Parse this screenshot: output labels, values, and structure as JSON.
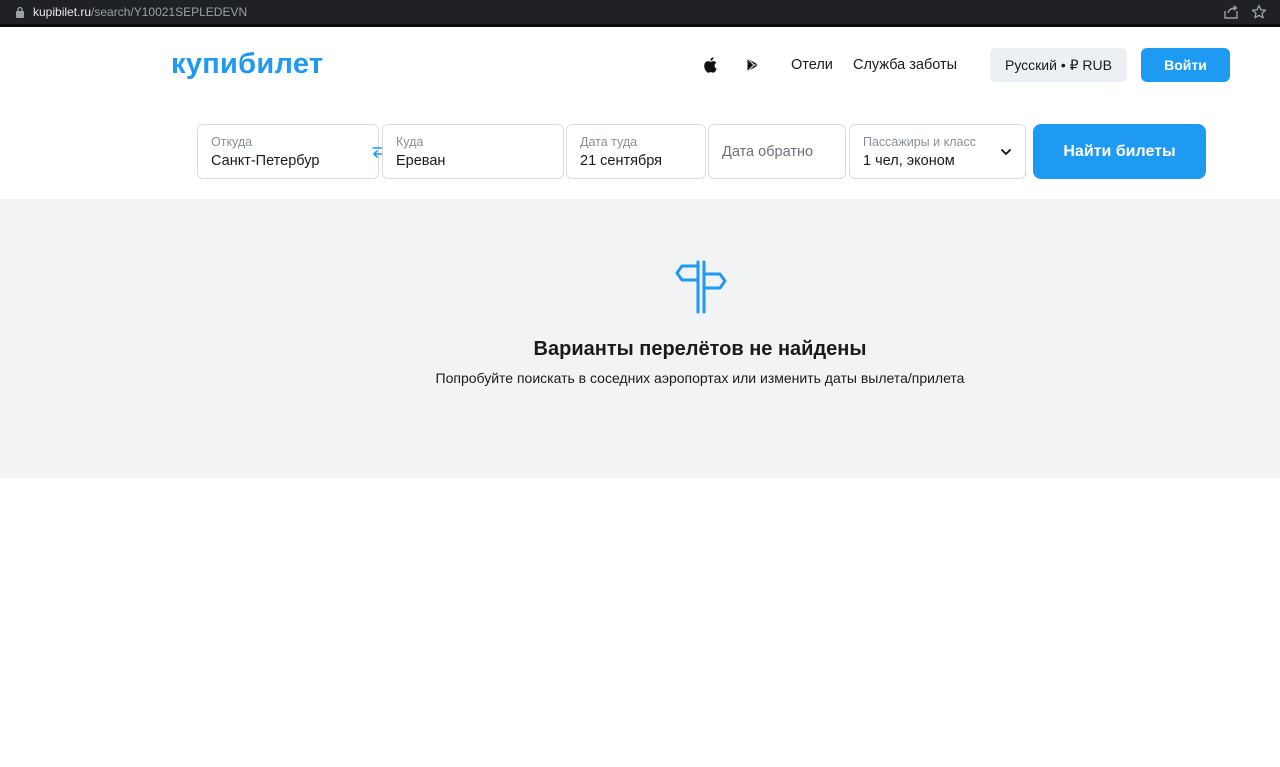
{
  "browser": {
    "url_host": "kupibilet.ru",
    "url_path": "/search/Y10021SEPLEDEVN"
  },
  "header": {
    "logo": "купибилет",
    "nav": [
      "Отели",
      "Служба заботы"
    ],
    "lang_currency": "Русский • ₽ RUB",
    "login": "Войти",
    "icons": [
      "apple-icon",
      "google-play-icon"
    ]
  },
  "search": {
    "from": {
      "label": "Откуда",
      "value": "Санкт-Петербург"
    },
    "to": {
      "label": "Куда",
      "value": "Ереван"
    },
    "date_there": {
      "label": "Дата туда",
      "value": "21 сентября"
    },
    "date_back": {
      "placeholder": "Дата обратно"
    },
    "passengers": {
      "label": "Пассажиры и класс",
      "value": "1 чел, эконом"
    },
    "submit": "Найти билеты"
  },
  "empty_state": {
    "title": "Варианты перелётов не найдены",
    "subtitle": "Попробуйте поискать в соседних аэропортах или изменить даты вылета/прилета"
  },
  "colors": {
    "brand": "#1e9af2",
    "empty_bg": "#f2f3f5",
    "button_gray": "#eceff3"
  }
}
